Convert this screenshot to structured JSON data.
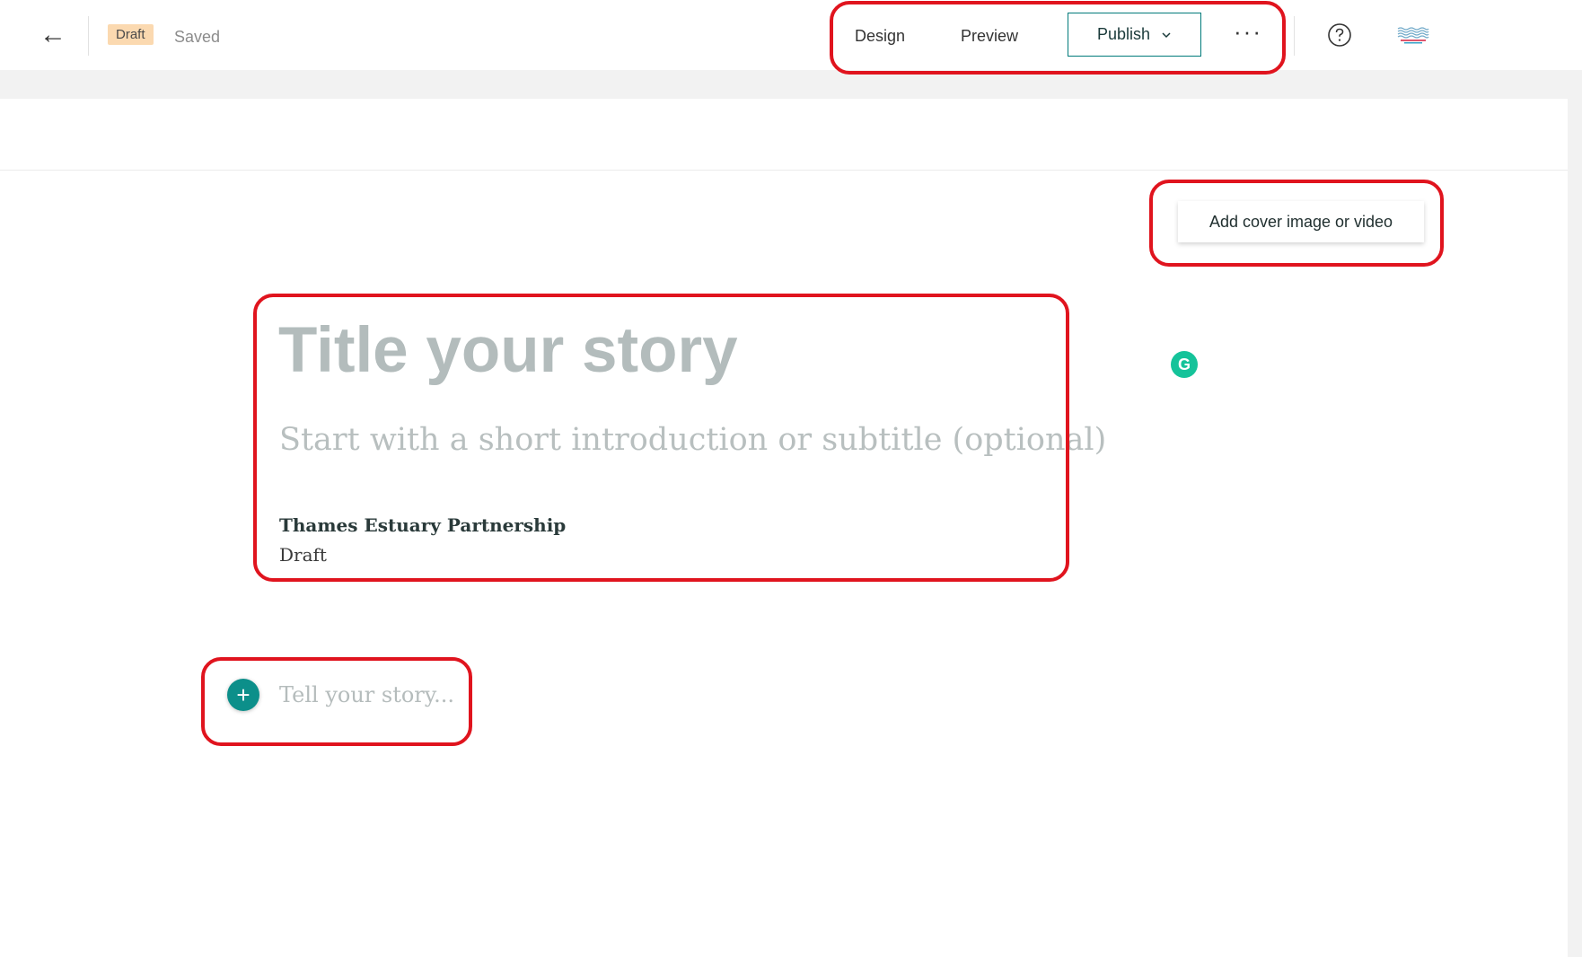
{
  "topbar": {
    "back_icon": "←",
    "draft_badge": "Draft",
    "saved_label": "Saved",
    "design_label": "Design",
    "preview_label": "Preview",
    "publish_label": "Publish",
    "more_label": "···",
    "help_icon": "question-circle-icon",
    "avatar_icon": "organization-logo"
  },
  "canvas": {
    "cover_button_label": "Add cover image or video",
    "title_placeholder": "Title your story",
    "subtitle_placeholder": "Start with a short introduction or subtitle (optional)",
    "author": "Thames Estuary Partnership",
    "status": "Draft",
    "body_placeholder": "Tell your story...",
    "grammarly_label": "G"
  },
  "colors": {
    "accent": "#0c8f8a",
    "badge_bg": "#fbd9b0",
    "highlight": "#e0141e",
    "grammarly": "#15c39a"
  }
}
